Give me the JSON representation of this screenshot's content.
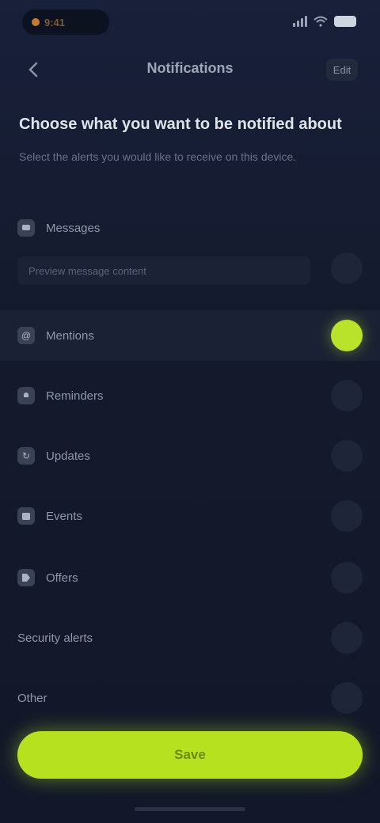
{
  "status_bar": {
    "time": "9:41"
  },
  "header": {
    "back_icon": "chevron-left-icon",
    "title": "Notifications",
    "action_label": "Edit"
  },
  "intro": {
    "heading": "Choose what you want to be notified about",
    "description": "Select the alerts you would like to receive on this device."
  },
  "rows": [
    {
      "id": "messages",
      "label": "Messages",
      "icon": "chat-icon",
      "on": false,
      "sub_field": "Preview message content"
    },
    {
      "id": "mentions",
      "label": "Mentions",
      "icon": "at-icon",
      "on": true
    },
    {
      "id": "reminders",
      "label": "Reminders",
      "icon": "bell-icon",
      "on": false
    },
    {
      "id": "updates",
      "label": "Updates",
      "icon": "refresh-icon",
      "on": false
    },
    {
      "id": "events",
      "label": "Events",
      "icon": "calendar-icon",
      "on": false
    },
    {
      "id": "offers",
      "label": "Offers",
      "icon": "tag-icon",
      "on": false
    },
    {
      "id": "security",
      "label": "Security alerts",
      "icon": "",
      "on": false
    },
    {
      "id": "other",
      "label": "Other",
      "icon": "",
      "on": false
    }
  ],
  "primary_button": {
    "label": "Save"
  },
  "colors": {
    "accent": "#b6e11e",
    "background": "#141a2a"
  }
}
